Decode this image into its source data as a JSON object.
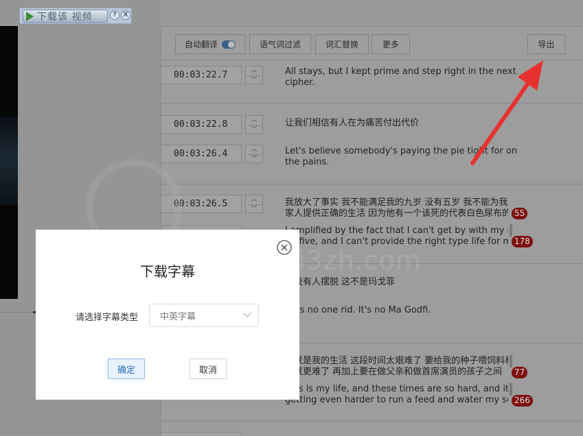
{
  "download_bar": {
    "label": "下载该 视频",
    "help": "?",
    "close": "X"
  },
  "toolbar": {
    "auto_translate": "自动翻译",
    "auto_translate_on": true,
    "filter_fillers": "语气词过滤",
    "replace_words": "词汇替换",
    "more": "更多",
    "export": "导出"
  },
  "rows": [
    {
      "time": "00:03:22.7",
      "text": [
        "All stays, but I kept prime and step right in the next",
        "cipher."
      ]
    },
    {
      "time": "00:03:22.8",
      "text": [
        "让我们相信有人在为痛苦付出代价"
      ]
    },
    {
      "time": "00:03:26.4",
      "text": [
        "Let's believe somebody's paying the pie tight for on",
        "the pains."
      ]
    },
    {
      "time": "00:03:26.5",
      "text": [
        "我放大了事实 我不能满足我的九岁 没有五岁 我不能为我的",
        "家人提供正确的生活 因为他有一个该死的代表白色尿布的人"
      ],
      "badge": "55"
    },
    {
      "time": "",
      "text": [
        "I amplified by the fact that I can't get by with my nine,",
        "no five, and I can't provide the right type life for my"
      ],
      "badge": "178"
    },
    {
      "time": "",
      "text": [
        "它没有人摆脱 这不是玛戈菲"
      ]
    },
    {
      "time": "",
      "text": [
        "It its no one rid. It's no Ma Godfi."
      ]
    },
    {
      "time": "",
      "text": [
        "这就是我的生活 这段时间太艰难了 要给我的种子喂饲料和",
        "水就更难了 再加上要在做父亲和做首席演员的孩子之间"
      ],
      "badge": "77"
    },
    {
      "time": "",
      "text": [
        "This is my life, and these times are so hard, and it's",
        "getting even harder to run a feed and water my seed,"
      ],
      "badge": "266"
    }
  ],
  "watermark": {
    "site": "www.i3zh.com"
  },
  "dialog": {
    "title": "下载字幕",
    "label": "请选择字幕类型",
    "selected": "中英字幕",
    "ok": "确定",
    "cancel": "取消"
  },
  "colors": {
    "overlay": "#9a9a9a",
    "badge": "#7e1010",
    "arrow": "#e8312f",
    "toggle": "#3a5f8a"
  }
}
